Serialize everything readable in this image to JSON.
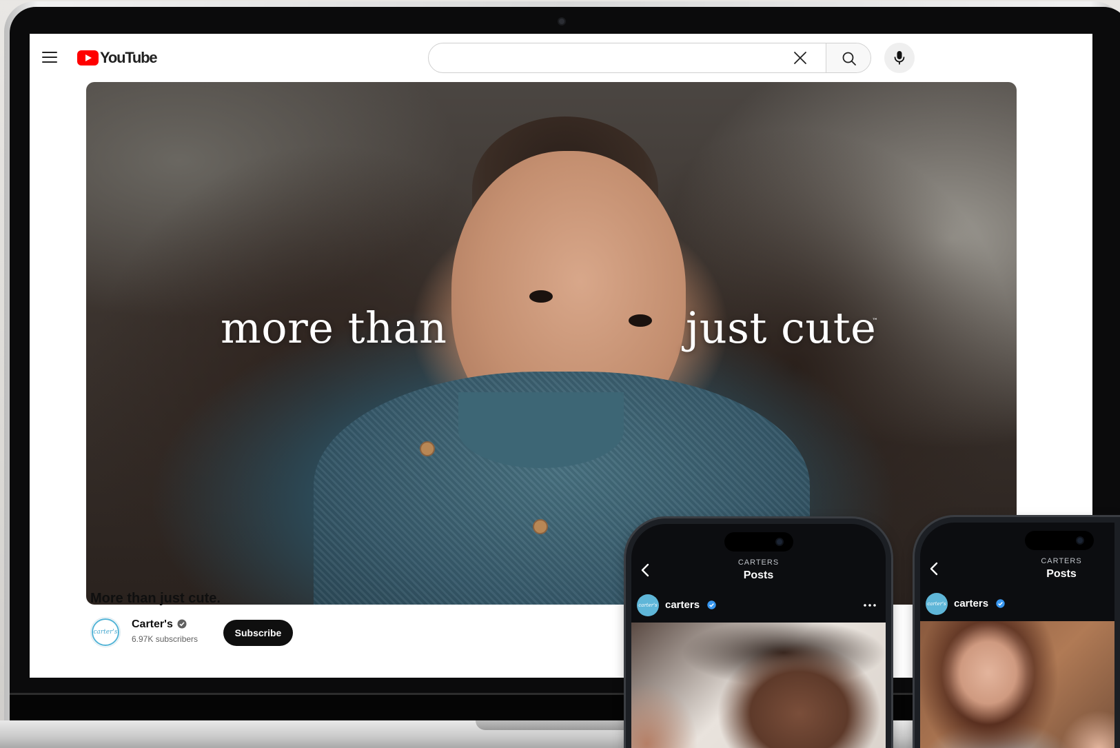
{
  "youtube": {
    "logo_text": "YouTube",
    "search_value": "",
    "video": {
      "overlay_left": "more than",
      "overlay_right": "just cute",
      "trademark": "™",
      "title": "More than just cute."
    },
    "channel": {
      "name": "Carter's",
      "avatar_text": "carter's",
      "subscribers": "6.97K subscribers",
      "subscribe_label": "Subscribe"
    }
  },
  "phones": [
    {
      "handle": "CARTERS",
      "title": "Posts",
      "username": "carters",
      "avatar_text": "carter's"
    },
    {
      "handle": "CARTERS",
      "title": "Posts",
      "username": "carters",
      "avatar_text": "carter's"
    }
  ],
  "colors": {
    "youtube_red": "#ff0000",
    "verified_blue": "#3897f0",
    "carters_blue": "#5fb6d8",
    "subscribe_bg": "#0f0f0f"
  },
  "icons": [
    "menu-icon",
    "youtube-logo-icon",
    "clear-icon",
    "search-icon",
    "mic-icon",
    "verified-icon",
    "back-icon",
    "more-icon"
  ]
}
